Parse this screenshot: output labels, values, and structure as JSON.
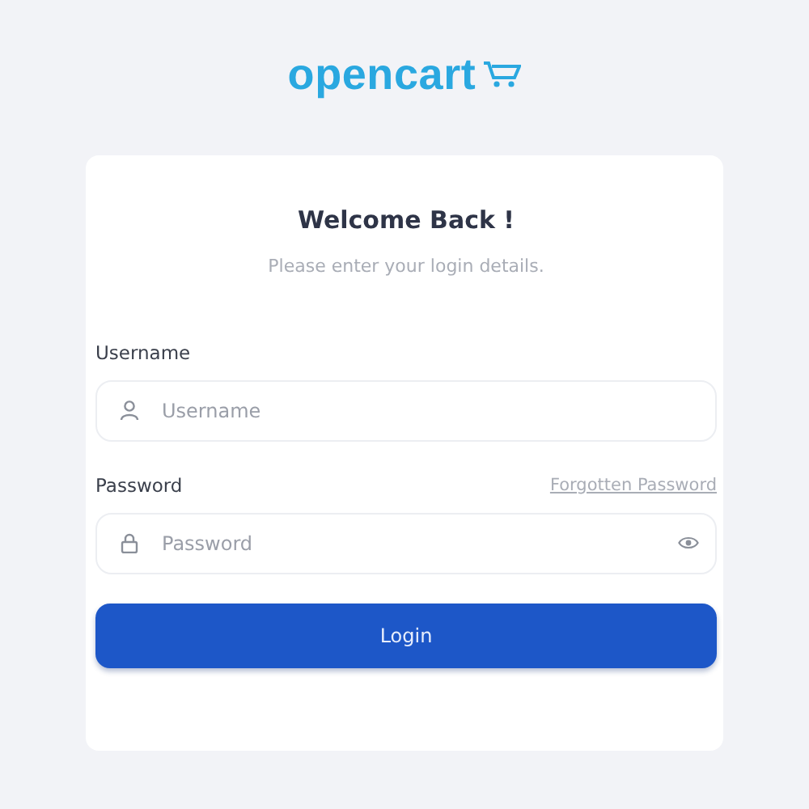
{
  "logo": {
    "text": "opencart"
  },
  "card": {
    "title": "Welcome Back !",
    "subtitle": "Please enter your login details.",
    "fields": [
      {
        "label": "Username",
        "placeholder": "Username",
        "kind": "user"
      },
      {
        "label": "Password",
        "placeholder": "Password",
        "kind": "password",
        "link": "Forgotten Password"
      }
    ],
    "button": "Login"
  }
}
